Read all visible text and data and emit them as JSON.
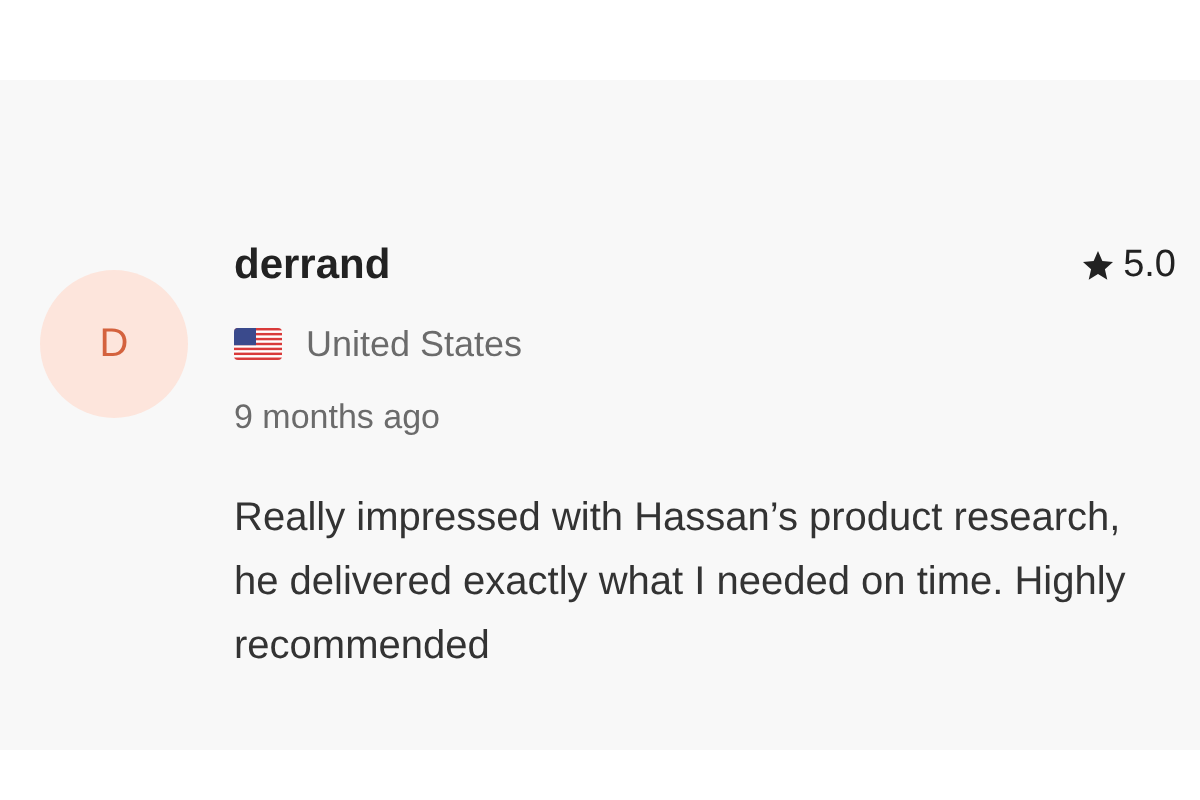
{
  "review": {
    "avatar_letter": "D",
    "reviewer": "derrand",
    "rating": "5.0",
    "country": "United States",
    "time": "9 months ago",
    "text": "Really impressed with Hassan’s product research, he delivered exactly what I needed on time. Highly recommended"
  }
}
